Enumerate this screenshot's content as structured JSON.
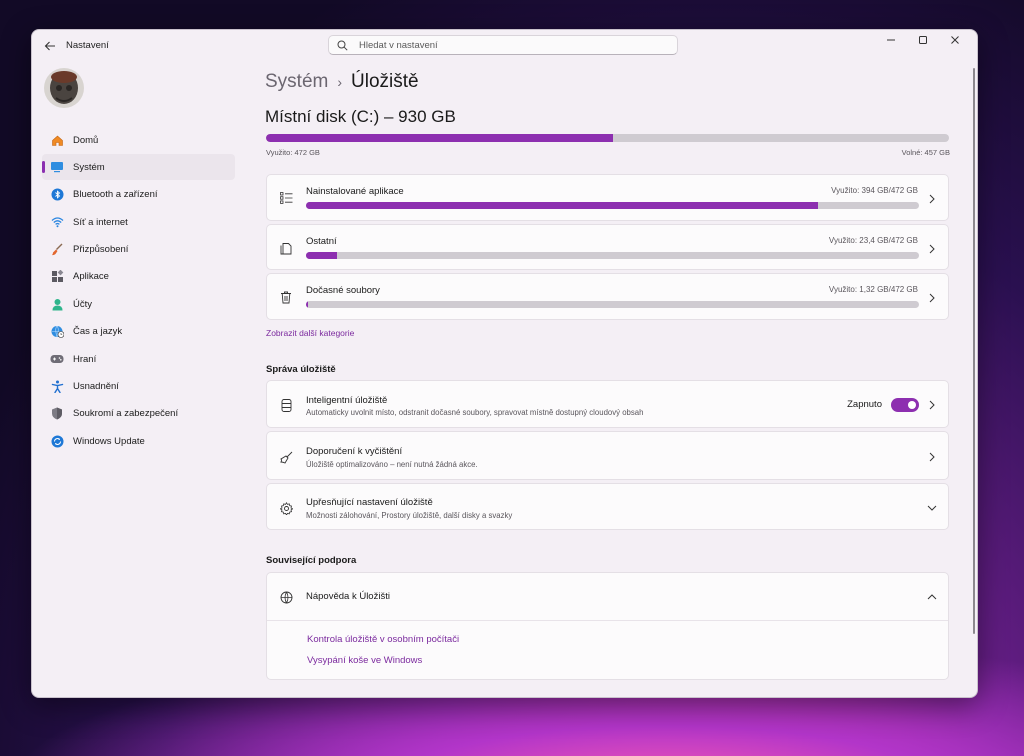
{
  "window": {
    "title": "Nastavení"
  },
  "search": {
    "placeholder": "Hledat v nastavení"
  },
  "sidebar": {
    "items": [
      {
        "label": "Domů",
        "icon": "home-icon"
      },
      {
        "label": "Systém",
        "icon": "system-icon",
        "active": true
      },
      {
        "label": "Bluetooth a zařízení",
        "icon": "bluetooth-icon"
      },
      {
        "label": "Síť a internet",
        "icon": "wifi-icon"
      },
      {
        "label": "Přizpůsobení",
        "icon": "brush-icon"
      },
      {
        "label": "Aplikace",
        "icon": "apps-icon"
      },
      {
        "label": "Účty",
        "icon": "person-icon"
      },
      {
        "label": "Čas a jazyk",
        "icon": "globe-clock-icon"
      },
      {
        "label": "Hraní",
        "icon": "gamepad-icon"
      },
      {
        "label": "Usnadnění",
        "icon": "accessibility-icon"
      },
      {
        "label": "Soukromí a zabezpečení",
        "icon": "shield-icon"
      },
      {
        "label": "Windows Update",
        "icon": "update-icon"
      }
    ]
  },
  "breadcrumb": {
    "parent": "Systém",
    "separator": "›",
    "current": "Úložiště"
  },
  "disk": {
    "title": "Místní disk (C:) – 930 GB",
    "used_label": "Využito: 472 GB",
    "free_label": "Volné: 457 GB",
    "used_fraction": 0.508
  },
  "categories": [
    {
      "name": "Nainstalované aplikace",
      "usage": "Využito: 394 GB/472 GB",
      "fraction": 0.835,
      "icon": "list-icon"
    },
    {
      "name": "Ostatní",
      "usage": "Využito: 23,4 GB/472 GB",
      "fraction": 0.05,
      "icon": "document-icon"
    },
    {
      "name": "Dočasné soubory",
      "usage": "Využito: 1,32 GB/472 GB",
      "fraction": 0.003,
      "icon": "trash-icon"
    }
  ],
  "more_categories_link": "Zobrazit další kategorie",
  "storage_management": {
    "section_title": "Správa úložiště",
    "storage_sense": {
      "title": "Inteligentní úložiště",
      "description": "Automaticky uvolnit místo, odstranit dočasné soubory, spravovat místně dostupný cloudový obsah",
      "toggle_label": "Zapnuto",
      "toggle_on": true
    },
    "cleanup": {
      "title": "Doporučení k vyčištění",
      "description": "Úložiště optimalizováno – není nutná žádná akce."
    },
    "advanced": {
      "title": "Upřesňující nastavení úložiště",
      "description": "Možnosti zálohování, Prostory úložiště, další disky a svazky"
    }
  },
  "related_support": {
    "section_title": "Související podpora",
    "help_title": "Nápověda k Úložišti",
    "links": [
      "Kontrola úložiště v osobním počítači",
      "Vysypání koše ve Windows"
    ]
  },
  "colors": {
    "accent": "#8d2fb0",
    "link": "#7b2a9e",
    "window_bg": "#f4eff5"
  }
}
